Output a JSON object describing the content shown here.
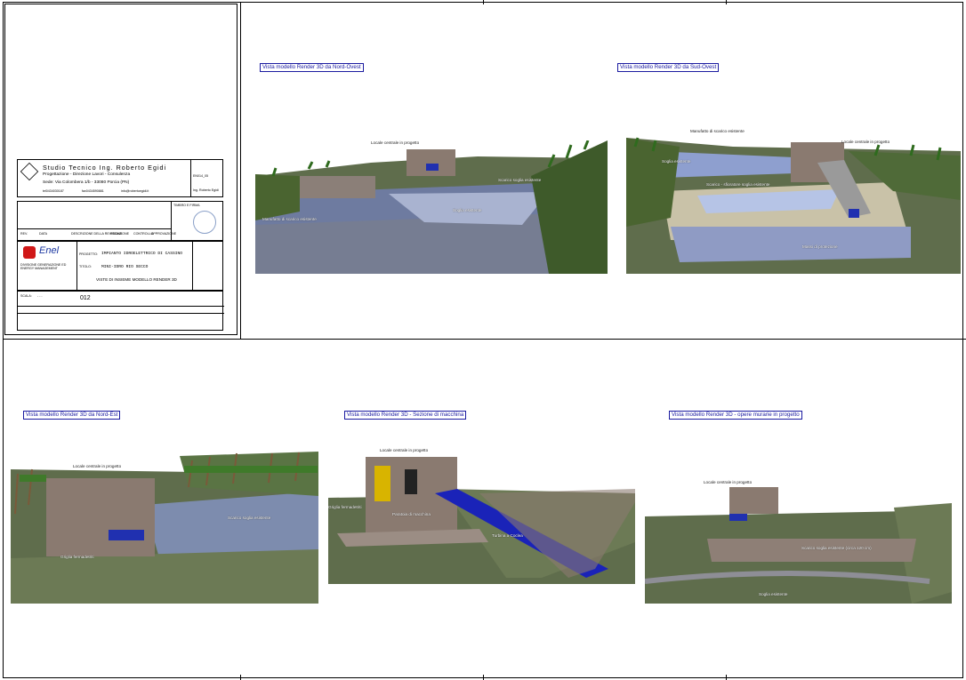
{
  "views": [
    {
      "caption": "Vista modello Render 3D da Nord-Ovest",
      "labels": [
        "Locale centrale in progetto",
        "Scarico soglia esistente",
        "Soglia esistente",
        "Manufatto di scarico esistente"
      ]
    },
    {
      "caption": "Vista modello Render 3D da Sud-Ovest",
      "labels": [
        "Manufatto di scarico esistente",
        "Locale centrale in progetto",
        "Soglia esistente",
        "Scarico - sfioratore soglia esistente",
        "Massi di protezione"
      ]
    },
    {
      "caption": "Vista modello Render 3D da Nord-Est",
      "labels": [
        "Locale centrale in progetto",
        "Scarico soglia esistente",
        "Griglia fermadetriti"
      ]
    },
    {
      "caption": "Vista modello Render 3D - Sezione di macchina",
      "labels": [
        "Locale centrale in progetto",
        "Griglia fermadetriti",
        "Paratoia di macchina",
        "Turbina a Coclea"
      ]
    },
    {
      "caption": "Vista modello Render 3D - opere murarie in progetto",
      "labels": [
        "Locale centrale in progetto",
        "Scarico soglia esistente (circa 120 cm)",
        "Soglia esistente"
      ]
    }
  ],
  "title_block": {
    "firm_name": "Studio Tecnico Ing. Roberto Egidi",
    "firm_services": "Progettazione - Direzione Lavori - Consulenza",
    "firm_address": "Sede: Via Colombera 1/b - 33080 Porcia (PN)",
    "firm_phone": "tel0434030187",
    "firm_fax": "fax0434590881",
    "firm_email": "info@robertoegidi.it",
    "revision_headers": [
      "REV.",
      "DATA",
      "DESCRIZIONE DELLA REVISIONE",
      "REDAZIONE",
      "CONTROLLO",
      "APPROVAZIONE"
    ],
    "doc_code": "EN014_05",
    "responsible": "Ing. Roberto Egidi",
    "stamp_label": "TIMBRO E FIRMA",
    "enel_logo": "Enel",
    "enel_division": "DIVISIONE GENERAZIONE ED ENERGY MANAGEMENT",
    "project_label": "PROGETTO:",
    "project": "IMPIANTO IDROELETTRICO DI CASSINO",
    "title_label": "TITOLO:",
    "title": "MINI-IDRO RIO SECCO",
    "subtitle": "VISTE DI INSIEME MODELLO RENDER 3D",
    "sheet_number": "012",
    "scale_label": "SCALA:",
    "scale": "- - -"
  }
}
